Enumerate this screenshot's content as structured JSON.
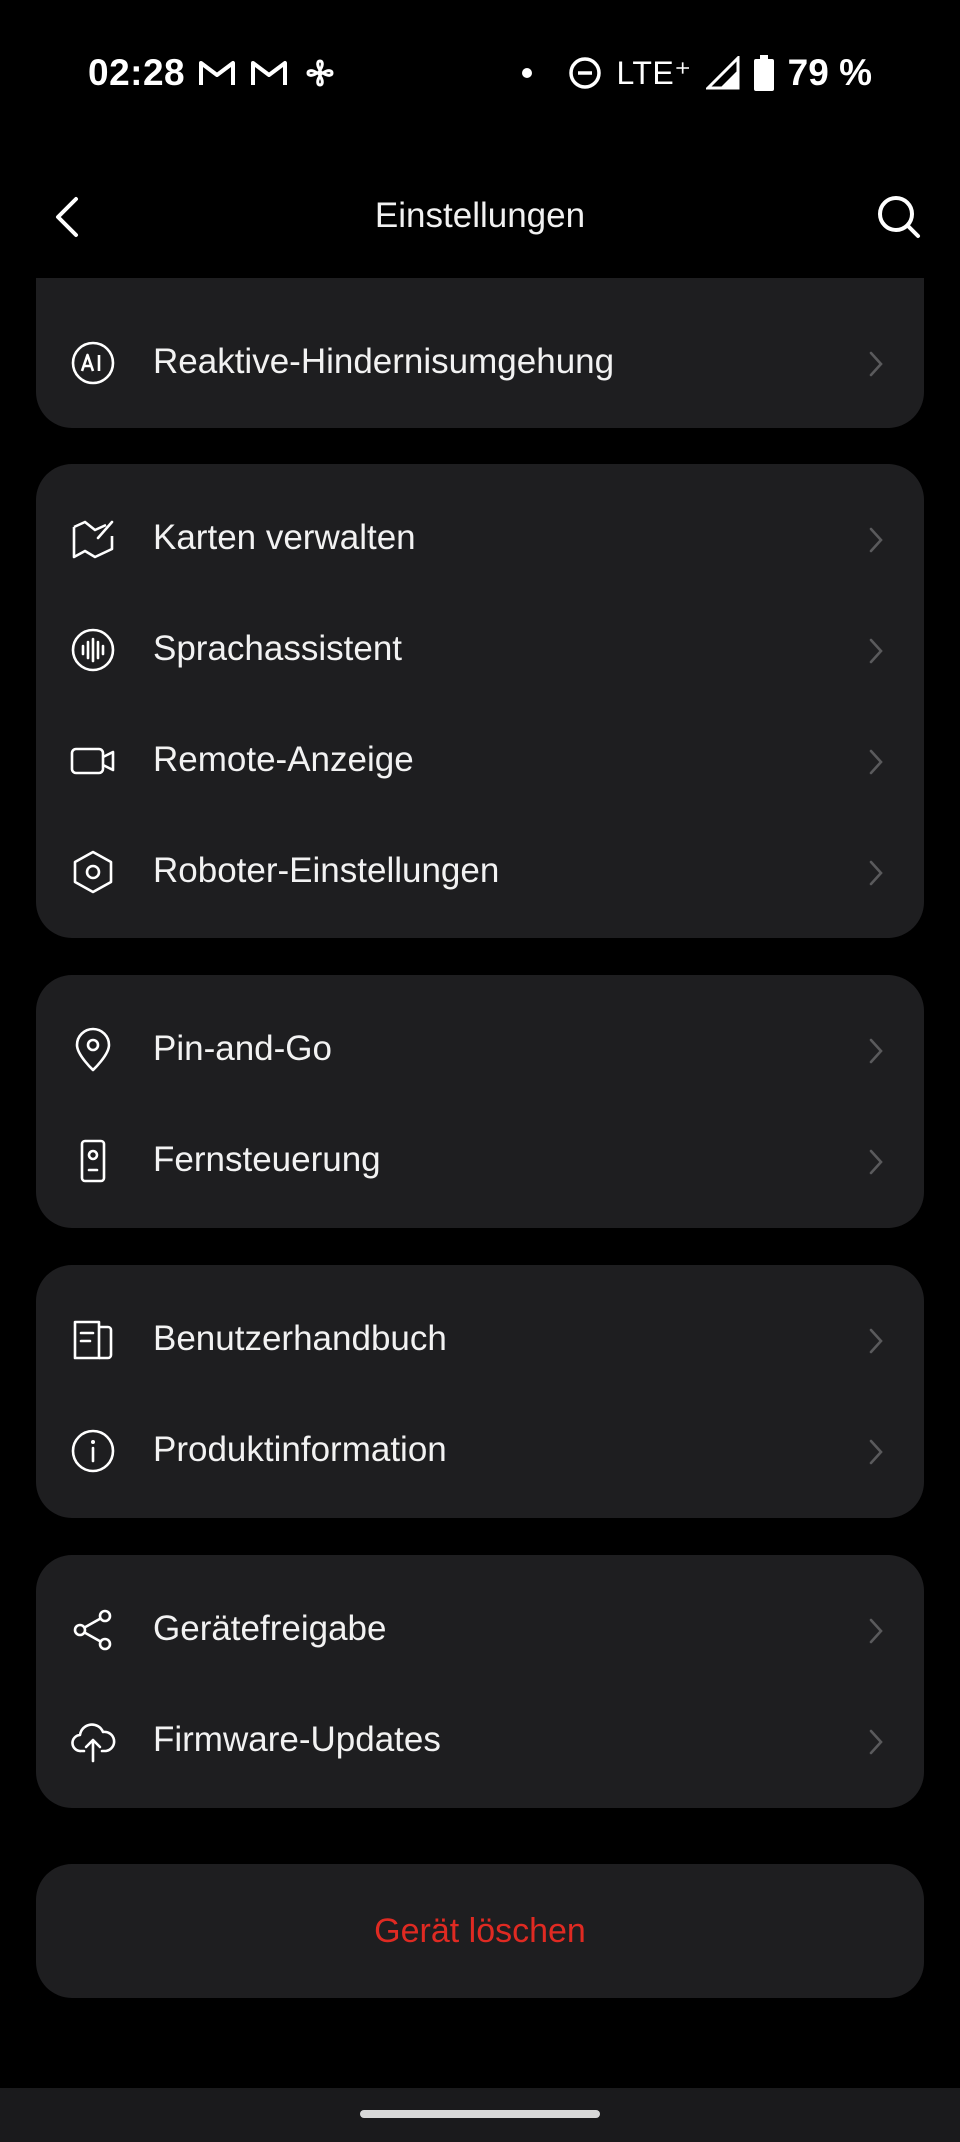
{
  "status_bar": {
    "time": "02:28",
    "left_icons": [
      "gmail-icon",
      "gmail-icon",
      "fan-icon"
    ],
    "network": "LTE⁺",
    "battery": "79 %",
    "right_icons": [
      "notification-dot",
      "do-not-disturb-icon",
      "signal-icon",
      "battery-icon"
    ]
  },
  "header": {
    "title": "Einstellungen",
    "back_icon": "chevron-left-icon",
    "search_icon": "search-icon"
  },
  "groups": [
    {
      "items": [
        {
          "label": "Reaktive-Hindernisumgehung",
          "icon": "ai-icon"
        }
      ]
    },
    {
      "items": [
        {
          "label": "Karten verwalten",
          "icon": "map-icon"
        },
        {
          "label": "Sprachassistent",
          "icon": "voice-icon"
        },
        {
          "label": "Remote-Anzeige",
          "icon": "video-camera-icon"
        },
        {
          "label": "Roboter-Einstellungen",
          "icon": "hexagon-settings-icon"
        }
      ]
    },
    {
      "items": [
        {
          "label": "Pin-and-Go",
          "icon": "location-pin-icon"
        },
        {
          "label": "Fernsteuerung",
          "icon": "remote-control-icon"
        }
      ]
    },
    {
      "items": [
        {
          "label": "Benutzerhandbuch",
          "icon": "manual-icon"
        },
        {
          "label": "Produktinformation",
          "icon": "info-icon"
        }
      ]
    },
    {
      "items": [
        {
          "label": "Gerätefreigabe",
          "icon": "share-icon"
        },
        {
          "label": "Firmware-Updates",
          "icon": "cloud-upload-icon"
        }
      ]
    }
  ],
  "delete_button": {
    "label": "Gerät löschen",
    "color": "#e02a22"
  },
  "colors": {
    "background": "#000000",
    "card": "#1e1e20",
    "text": "#f2f2f2",
    "chevron": "#5a5a5c"
  }
}
